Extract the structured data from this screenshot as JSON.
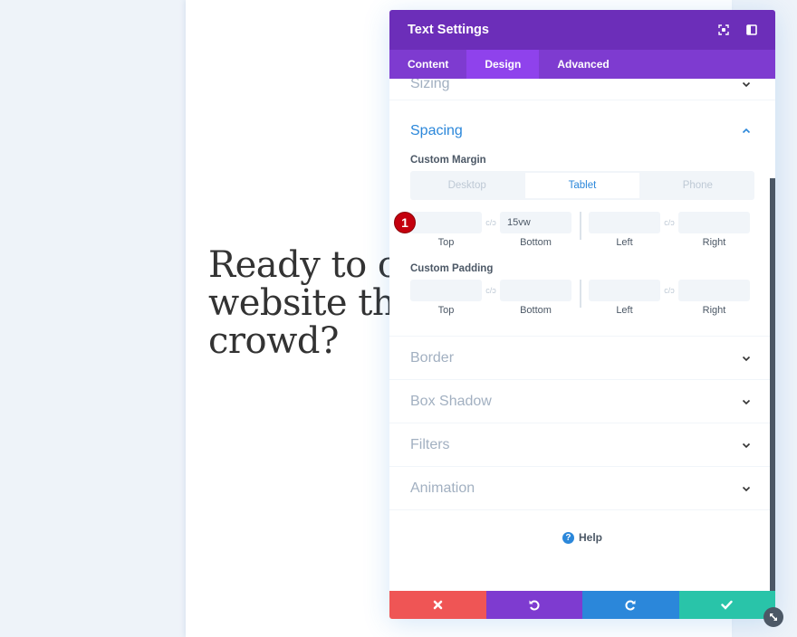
{
  "page": {
    "headline": "Ready to cr\nwebsite tha\ncrowd?"
  },
  "modal": {
    "title": "Text Settings",
    "header_icons": [
      "focus-mode-icon",
      "split-view-icon"
    ],
    "tabs": [
      {
        "label": "Content",
        "active": false
      },
      {
        "label": "Design",
        "active": true
      },
      {
        "label": "Advanced",
        "active": false
      }
    ],
    "sections": {
      "sizing": "Sizing",
      "spacing": "Spacing",
      "border": "Border",
      "box_shadow": "Box Shadow",
      "filters": "Filters",
      "animation": "Animation"
    },
    "spacing": {
      "custom_margin_label": "Custom Margin",
      "custom_padding_label": "Custom Padding",
      "device_tabs": [
        {
          "label": "Desktop",
          "active": false
        },
        {
          "label": "Tablet",
          "active": true
        },
        {
          "label": "Phone",
          "active": false
        }
      ],
      "margin": {
        "top": "",
        "bottom": "15vw",
        "left": "",
        "right": ""
      },
      "padding": {
        "top": "",
        "bottom": "",
        "left": "",
        "right": ""
      },
      "field_labels": {
        "top": "Top",
        "bottom": "Bottom",
        "left": "Left",
        "right": "Right"
      },
      "link_glyph": "c/ↄ"
    },
    "step_badge": "1",
    "help_label": "Help",
    "footer": {
      "cancel": "cancel",
      "undo": "undo",
      "redo": "redo",
      "save": "save"
    }
  },
  "colors": {
    "header": "#6c2eb9",
    "tabs": "#7e3bd0",
    "active_tab": "#8f42ec",
    "accent_blue": "#2b87da",
    "cancel": "#ef5555",
    "undo": "#7e3bd0",
    "redo": "#2b87da",
    "save": "#29c4a9",
    "badge": "#c4000e"
  }
}
